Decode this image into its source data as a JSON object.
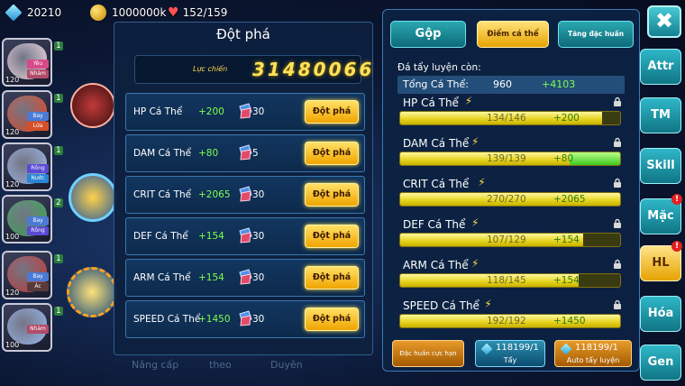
{
  "currency": {
    "gems": "20210",
    "gold": "1000000k",
    "stamina": "152/159"
  },
  "heroes": [
    {
      "level": "120",
      "rank": "1",
      "tags": [
        "Yêu",
        "Nhảm"
      ],
      "color": "#f3d9e6",
      "tag_colors": [
        "#d64a8a",
        "#b24b6a"
      ]
    },
    {
      "level": "120",
      "rank": "1",
      "tags": [
        "Bay",
        "Lửa"
      ],
      "color": "#e24a2a",
      "tag_colors": [
        "#4a7ad6",
        "#d6502a"
      ]
    },
    {
      "level": "120",
      "rank": "1",
      "tags": [
        "Rồng",
        "Nước"
      ],
      "color": "#9fb8e8",
      "tag_colors": [
        "#5a4ad6",
        "#2a86d6"
      ]
    },
    {
      "level": "100",
      "rank": "2",
      "tags": [
        "Bay",
        "Rồng"
      ],
      "color": "#3ea85a",
      "tag_colors": [
        "#4a7ad6",
        "#5a4ad6"
      ]
    },
    {
      "level": "120",
      "rank": "1",
      "tags": [
        "Bay",
        "Ác"
      ],
      "color": "#c23a3a",
      "tag_colors": [
        "#4a7ad6",
        "#5a3a3a"
      ]
    },
    {
      "level": "100",
      "rank": "1",
      "tags": [
        "Nhảm"
      ],
      "color": "#9ab8ee",
      "tag_colors": [
        "#b24b6a"
      ]
    }
  ],
  "breakthrough_panel": {
    "title": "Đột phá",
    "power_label": "Lực chiến",
    "power_value": "31480066",
    "rows": [
      {
        "name": "HP Cá Thể",
        "bonus": "+200",
        "cost": "30",
        "button": "Đột phá"
      },
      {
        "name": "DAM Cá Thể",
        "bonus": "+80",
        "cost": "5",
        "button": "Đột phá"
      },
      {
        "name": "CRIT Cá Thể",
        "bonus": "+2065",
        "cost": "30",
        "button": "Đột phá"
      },
      {
        "name": "DEF Cá Thể",
        "bonus": "+154",
        "cost": "30",
        "button": "Đột phá"
      },
      {
        "name": "ARM Cá Thể",
        "bonus": "+154",
        "cost": "30",
        "button": "Đột phá"
      },
      {
        "name": "SPEED Cá Thể",
        "bonus": "+1450",
        "cost": "30",
        "button": "Đột phá"
      }
    ]
  },
  "bottom_tabs": [
    "Nâng cấp",
    "theo",
    "Duyên"
  ],
  "detail_panel": {
    "tabs": {
      "gop": "Gộp",
      "diem_ca_the": "Điểm cá thể",
      "tang_dac_huan": "Tăng đặc huấn"
    },
    "remain_label": "Đá tẩy luyện còn:",
    "total_label": "Tổng Cá Thể:",
    "total_value": "960",
    "total_bonus": "+4103",
    "stats": [
      {
        "name": "HP Cá Thể",
        "value": "134/146",
        "bonus": "+200",
        "current": 134,
        "max": 146,
        "bonus_fraction": 0
      },
      {
        "name": "DAM Cá Thể",
        "value": "139/139",
        "bonus": "+80",
        "current": 139,
        "max": 139,
        "bonus_fraction": 0.23
      },
      {
        "name": "CRIT Cá Thể",
        "value": "270/270",
        "bonus": "+2065",
        "current": 270,
        "max": 270,
        "bonus_fraction": 0
      },
      {
        "name": "DEF Cá Thể",
        "value": "107/129",
        "bonus": "+154",
        "current": 107,
        "max": 129,
        "bonus_fraction": 0
      },
      {
        "name": "ARM Cá Thể",
        "value": "118/145",
        "bonus": "+154",
        "current": 118,
        "max": 145,
        "bonus_fraction": 0
      },
      {
        "name": "SPEED Cá Thể",
        "value": "192/192",
        "bonus": "+1450",
        "current": 192,
        "max": 192,
        "bonus_fraction": 0
      }
    ],
    "actions": {
      "dac_huan": "Đặc huấn cực hạn",
      "tay_count": "118199/1",
      "tay_label": "Tẩy",
      "auto_count": "118199/1",
      "auto_label": "Auto tẩy luyện"
    }
  },
  "nav": {
    "close_icon": "✖",
    "items": [
      {
        "label": "Attr",
        "alert": false,
        "active": false
      },
      {
        "label": "TM",
        "alert": false,
        "active": false
      },
      {
        "label": "Skill",
        "alert": false,
        "active": false
      },
      {
        "label": "Mặc",
        "alert": true,
        "active": false
      },
      {
        "label": "HL",
        "alert": true,
        "active": true
      },
      {
        "label": "Hóa",
        "alert": false,
        "active": false
      },
      {
        "label": "Gen",
        "alert": false,
        "active": false
      }
    ],
    "alert_mark": "!"
  },
  "colors": {
    "accent_gold": "#ffe35a",
    "bonus_green": "#7dff4f",
    "panel_bg": "#0c2242"
  }
}
